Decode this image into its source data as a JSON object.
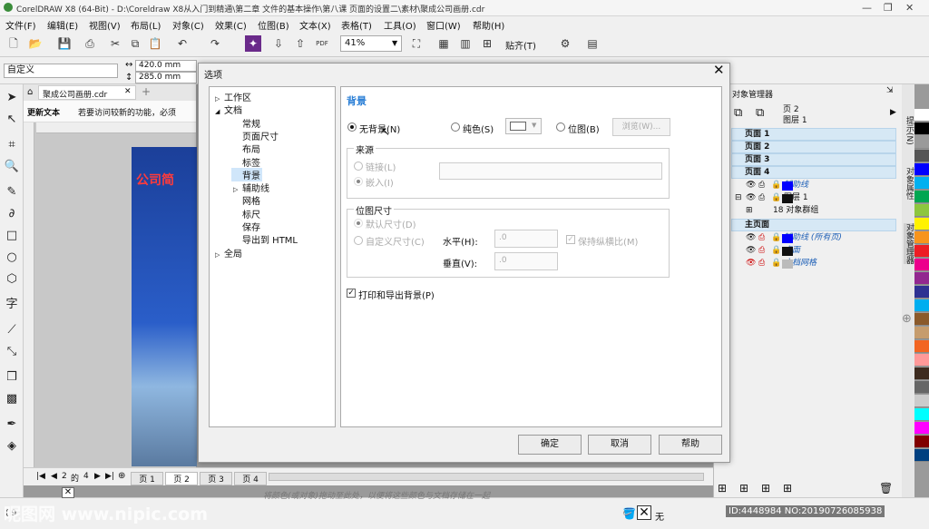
{
  "window": {
    "title": "CorelDRAW X8 (64-Bit) - D:\\Coreldraw X8从入门到精通\\第二章 文件的基本操作\\第八课 页面的设置二\\素材\\聚成公司画册.cdr"
  },
  "menu": [
    "文件(F)",
    "编辑(E)",
    "视图(V)",
    "布局(L)",
    "对象(C)",
    "效果(C)",
    "位图(B)",
    "文本(X)",
    "表格(T)",
    "工具(O)",
    "窗口(W)",
    "帮助(H)"
  ],
  "toolbar": {
    "zoom": "41%",
    "snap": "贴齐(T)"
  },
  "propbar": {
    "preset": "自定义",
    "width": "420.0 mm",
    "height": "285.0 mm"
  },
  "document": {
    "tab": "聚成公司画册.cdr",
    "update_title": "更新文本",
    "update_msg": "若要访问较新的功能，必须",
    "page_heading": "公司简"
  },
  "page_nav": {
    "current": "2",
    "sep": "的",
    "total": "4",
    "tabs": [
      "页 1",
      "页 2",
      "页 3",
      "页 4"
    ]
  },
  "status": {
    "hint": "将颜色(或对象)拖动至此处，以便将这些颜色与文档存储在一起",
    "fill_none": "无",
    "coords": "( 9"
  },
  "watermark": {
    "left": "昵图网 www.nipic.com",
    "right": "ID:4448984 NO:20190726085938"
  },
  "objects_panel": {
    "title": "对象管理器",
    "header_page": "页 2",
    "header_layer": "图层 1",
    "pages": [
      "页面 1",
      "页面 2",
      "页面 3",
      "页面 4"
    ],
    "layers_p4": [
      {
        "name": "辅助线",
        "color": "#0000ff"
      },
      {
        "name": "图层 1",
        "color": "#111111"
      }
    ],
    "group": "18 对象群组",
    "master": "主页面",
    "layers_master": [
      {
        "name": "辅助线 (所有页)",
        "color": "#0000ff"
      },
      {
        "name": "桌面",
        "color": "#111111"
      },
      {
        "name": "文档网格",
        "color": "#bbbbbb"
      }
    ]
  },
  "side_tabs": [
    "提示(N)",
    "对象属性",
    "对象管理器"
  ],
  "palette": [
    "#ffffff",
    "#000000",
    "#9a9a9a",
    "#555555",
    "#0000ff",
    "#00b0f0",
    "#00a651",
    "#8dc63f",
    "#fff200",
    "#f7941d",
    "#ed1c24",
    "#ec008c",
    "#92278f",
    "#2e3192",
    "#00aeef",
    "#8b5a2b",
    "#c69c6d",
    "#f26522",
    "#ff9999",
    "#3d2b1f",
    "#666666",
    "#cccccc",
    "#00ffff",
    "#ff00ff",
    "#800000",
    "#004080"
  ],
  "dialog": {
    "title": "选项",
    "tree": [
      {
        "label": "工作区",
        "level": 0,
        "arrow": "▷"
      },
      {
        "label": "文档",
        "level": 0,
        "arrow": "◢"
      },
      {
        "label": "常规",
        "level": 1,
        "arrow": ""
      },
      {
        "label": "页面尺寸",
        "level": 1,
        "arrow": ""
      },
      {
        "label": "布局",
        "level": 1,
        "arrow": ""
      },
      {
        "label": "标签",
        "level": 1,
        "arrow": ""
      },
      {
        "label": "背景",
        "level": 1,
        "arrow": "",
        "selected": true
      },
      {
        "label": "辅助线",
        "level": 1,
        "arrow": "▷"
      },
      {
        "label": "网格",
        "level": 1,
        "arrow": ""
      },
      {
        "label": "标尺",
        "level": 1,
        "arrow": ""
      },
      {
        "label": "保存",
        "level": 1,
        "arrow": ""
      },
      {
        "label": "导出到 HTML",
        "level": 1,
        "arrow": ""
      },
      {
        "label": "全局",
        "level": 0,
        "arrow": "▷"
      }
    ],
    "section": "背景",
    "bg_none": "无背景(N)",
    "bg_solid": "纯色(S)",
    "bg_bitmap": "位图(B)",
    "browse": "浏览(W)...",
    "source_group": "来源",
    "link": "链接(L)",
    "embed": "嵌入(I)",
    "size_group": "位图尺寸",
    "default_size": "默认尺寸(D)",
    "custom_size": "自定义尺寸(C)",
    "horizontal": "水平(H):",
    "vertical": "垂直(V):",
    "h_value": ".0",
    "v_value": ".0",
    "keep_ratio": "保持纵横比(M)",
    "print_export": "打印和导出背景(P)",
    "ok": "确定",
    "cancel": "取消",
    "help": "帮助"
  }
}
